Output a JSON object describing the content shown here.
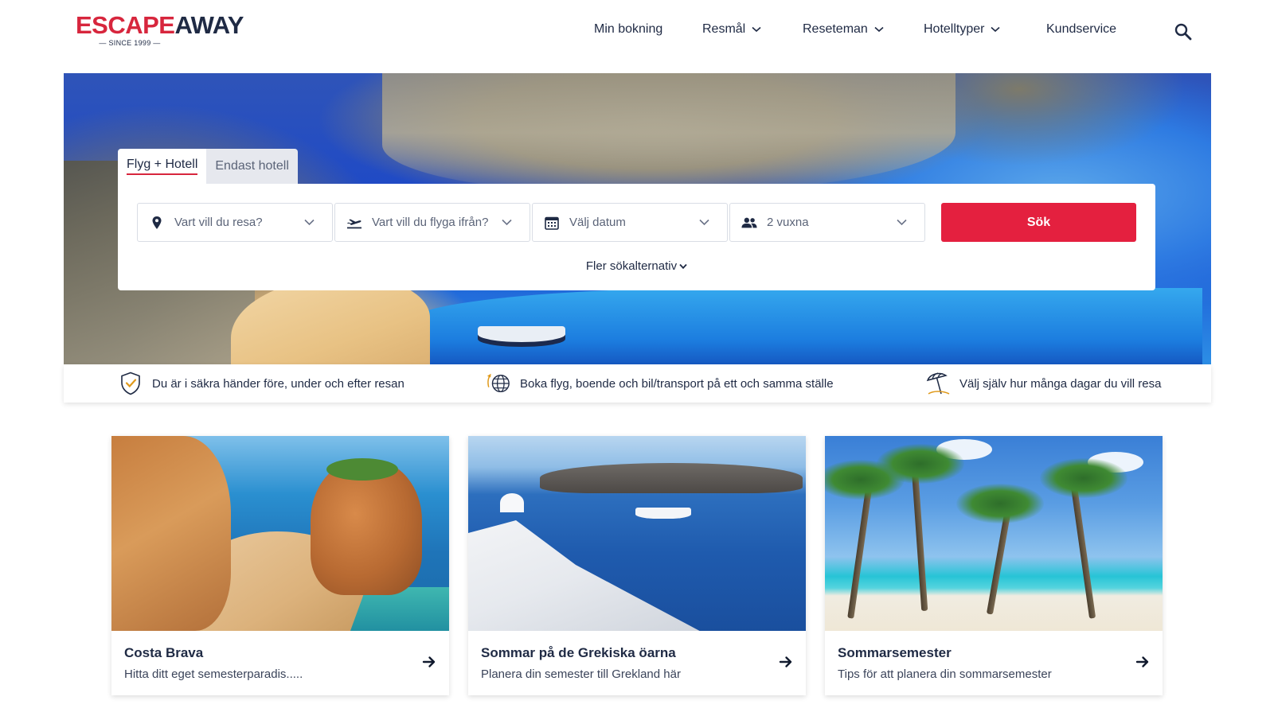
{
  "brand": {
    "logo_part1": "ESCAPE",
    "logo_part2": "AWAY",
    "tagline": "— SINCE 1999 —",
    "accent_color": "#d7263d",
    "navy_color": "#1f2a44"
  },
  "nav": {
    "items": [
      {
        "label": "Min bokning",
        "dropdown": false
      },
      {
        "label": "Resmål",
        "dropdown": true
      },
      {
        "label": "Reseteman",
        "dropdown": true
      },
      {
        "label": "Hotelltyper",
        "dropdown": true
      },
      {
        "label": "Kundservice",
        "dropdown": false
      }
    ],
    "search_icon": "search-icon"
  },
  "search": {
    "tabs": [
      {
        "label": "Flyg + Hotell",
        "active": true
      },
      {
        "label": "Endast hotell",
        "active": false
      }
    ],
    "fields": [
      {
        "icon": "location-pin-icon",
        "placeholder": "Vart vill du resa?"
      },
      {
        "icon": "airplane-takeoff-icon",
        "placeholder": "Vart vill du flyga ifrån?"
      },
      {
        "icon": "calendar-icon",
        "placeholder": "Välj datum"
      },
      {
        "icon": "people-icon",
        "value": "2 vuxna"
      }
    ],
    "submit_label": "Sök",
    "submit_color": "#e4203f",
    "more_options_label": "Fler sökalternativ"
  },
  "usps": [
    {
      "icon": "shield-check-icon",
      "text": "Du är i säkra händer före, under och efter resan"
    },
    {
      "icon": "globe-plane-icon",
      "text": "Boka flyg, boende och bil/transport på ett och samma ställe"
    },
    {
      "icon": "umbrella-beach-icon",
      "text": "Välj själv hur många dagar du vill resa"
    }
  ],
  "cards": [
    {
      "title": "Costa Brava",
      "subtitle": "Hitta ditt eget semesterparadis.....",
      "image": "costa-brava-beach"
    },
    {
      "title": "Sommar på de Grekiska öarna",
      "subtitle": "Planera din semester till Grekland här",
      "image": "santorini-view"
    },
    {
      "title": "Sommarsemester",
      "subtitle": "Tips för att planera din sommarsemester",
      "image": "palm-beach"
    }
  ]
}
